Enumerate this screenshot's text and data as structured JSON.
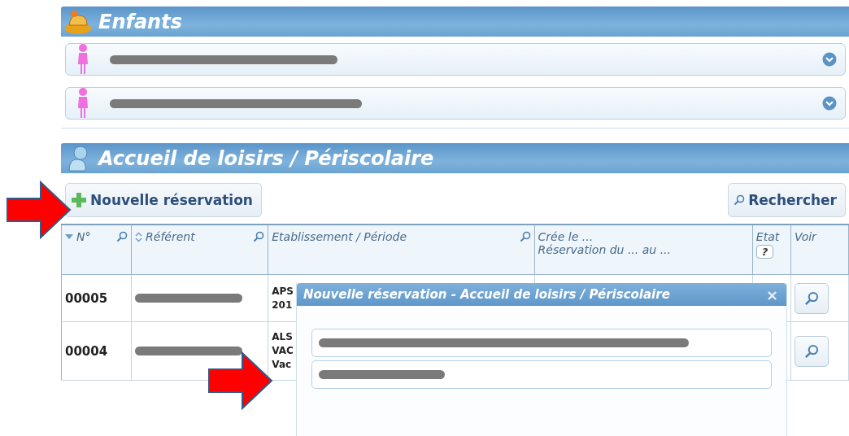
{
  "children_panel": {
    "title": "Enfants",
    "children": [
      {
        "kind": "girl",
        "name": {
          "kind": "redacted"
        },
        "expanded": false
      },
      {
        "kind": "girl",
        "name": {
          "kind": "redacted"
        },
        "expanded": false
      }
    ]
  },
  "leisure_panel": {
    "title": "Accueil de loisirs / Périscolaire",
    "new_button": "Nouvelle réservation",
    "search_button": "Rechercher",
    "table": {
      "columns": [
        {
          "lines": [
            "N°"
          ],
          "sortable": true,
          "sorted": true,
          "searchable": true
        },
        {
          "lines": [
            "Référent"
          ],
          "sortable": true,
          "sorted": false,
          "searchable": true
        },
        {
          "lines": [
            "Etablissement / Période"
          ],
          "sortable": false,
          "searchable": true
        },
        {
          "lines": [
            "Crée le ...",
            "Réservation du ... au ..."
          ],
          "sortable": false,
          "searchable": false
        },
        {
          "lines": [
            "Etat"
          ],
          "sortable": false,
          "searchable": false,
          "help_button": "?"
        },
        {
          "lines": [
            "Voir"
          ],
          "sortable": false,
          "searchable": false
        }
      ],
      "rows": [
        {
          "number": "00005",
          "referent": {
            "kind": "redacted"
          },
          "establishment": [
            "APS",
            "201"
          ]
        },
        {
          "number": "00004",
          "referent": {
            "kind": "redacted"
          },
          "establishment": [
            "ALS",
            "VAC",
            "Vac"
          ]
        }
      ]
    }
  },
  "dialog": {
    "title": "Nouvelle réservation - Accueil de loisirs / Périscolaire",
    "close": "×",
    "fields": [
      {
        "kind": "redacted"
      },
      {
        "kind": "redacted"
      }
    ]
  },
  "annotations": [
    {
      "kind": "red-arrow"
    },
    {
      "kind": "red-arrow"
    }
  ]
}
